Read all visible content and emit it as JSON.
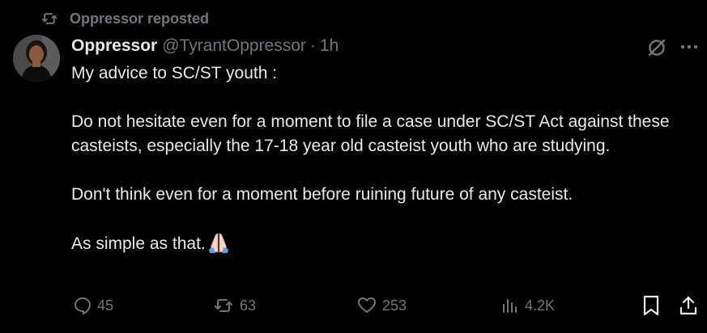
{
  "repost": {
    "label": "Oppressor reposted"
  },
  "author": {
    "display_name": "Oppressor",
    "handle": "@TyrantOppressor",
    "separator": "·",
    "time": "1h"
  },
  "tweet": {
    "paragraphs": [
      "My advice to SC/ST youth :",
      "Do not hesitate even for a moment to file a case under SC/ST Act against these casteists, especially the 17-18 year old casteist youth who are studying.",
      "Don't think even for a moment before ruining future of any casteist.",
      "As simple as that."
    ],
    "emoji": "folded-hands-emoji"
  },
  "actions": {
    "replies": "45",
    "reposts": "63",
    "likes": "253",
    "views": "4.2K"
  },
  "icons": {
    "repost": "repost-icon",
    "grok": "grok-icon",
    "more": "more-icon",
    "reply": "reply-icon",
    "like": "heart-icon",
    "views": "views-icon",
    "bookmark": "bookmark-icon",
    "share": "share-icon"
  },
  "colors": {
    "background": "#000000",
    "text_primary": "#e7e9ea",
    "text_secondary": "#71767b"
  }
}
